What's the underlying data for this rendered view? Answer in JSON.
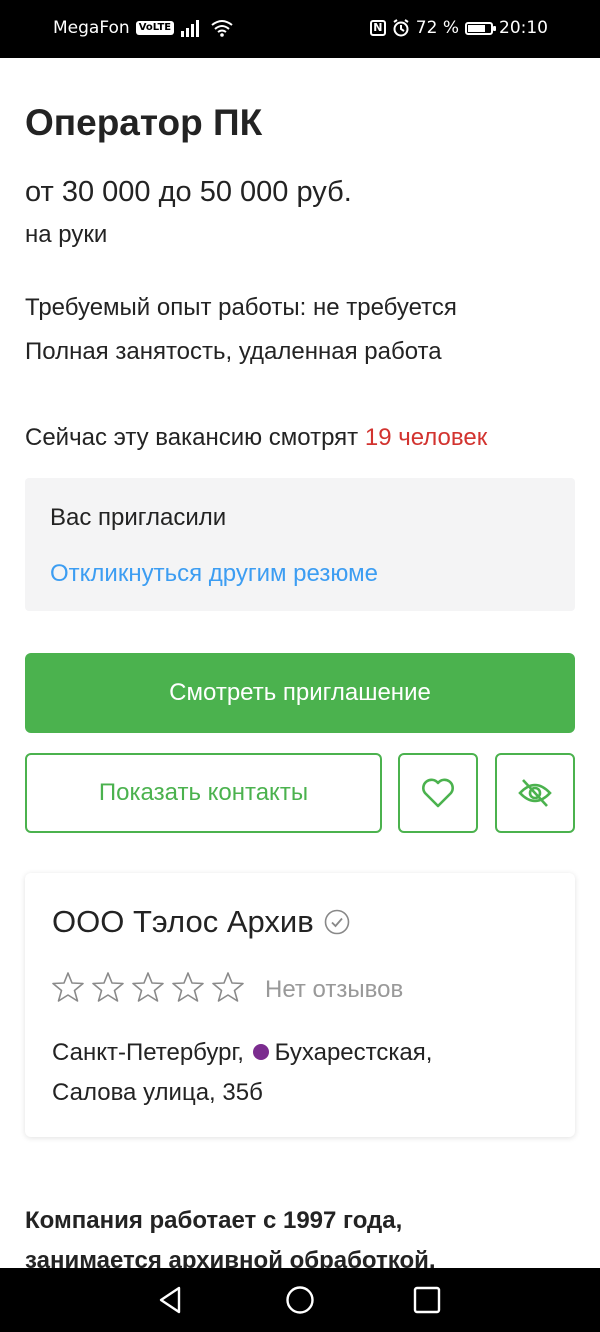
{
  "status_bar": {
    "carrier": "MegaFon",
    "volte": "VoLTE",
    "battery": "72 %",
    "battery_level": 0.72,
    "time": "20:10"
  },
  "vacancy": {
    "title": "Оператор ПК",
    "salary": "от 30 000 до 50 000 руб.",
    "salary_note": "на руки",
    "experience": "Требуемый опыт работы: не требуется",
    "employment": "Полная занятость, удаленная работа",
    "viewers_prefix": "Сейчас эту вакансию смотрят ",
    "viewers_count": "19 человек"
  },
  "invite": {
    "label": "Вас пригласили",
    "link": "Откликнуться другим резюме"
  },
  "actions": {
    "view_invitation": "Смотреть приглашение",
    "show_contacts": "Показать контакты"
  },
  "company": {
    "name": "ООО Тэлос Архив",
    "rating_stars": 0,
    "reviews": "Нет отзывов",
    "city": "Санкт-Петербург,",
    "metro": "Бухарестская,",
    "street": "Салова улица, 35б"
  },
  "description": {
    "line1": "Компания работает с 1997 года,",
    "line2": "занимается архивной обработкой,"
  },
  "colors": {
    "accent_green": "#4bb24e",
    "link_blue": "#3c9df2",
    "highlight_red": "#d2332f",
    "metro_purple": "#7b2c8f"
  }
}
